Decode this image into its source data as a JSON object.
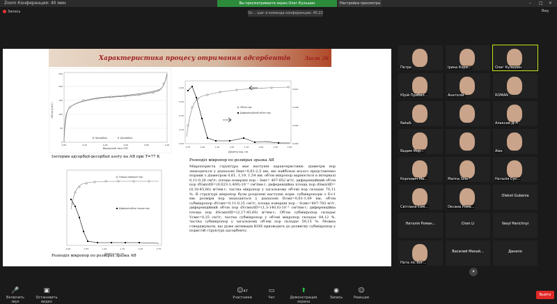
{
  "window": {
    "title": "Zoom Конференция: 40 мин",
    "controls": [
      "–",
      "□",
      "×"
    ]
  },
  "recording": {
    "label": "Запись"
  },
  "banner": {
    "speaking": "Вы просматриваете экран Олег Кульшин",
    "view_options": "Настройки просмотра",
    "role": "Ос… шаг в команда конференции: 45:22"
  },
  "view_button": "Вид",
  "slide": {
    "title": "Характеристика процесу отримання адсорбентів",
    "sheet": "Лист 26",
    "fig1": {
      "caption": "Ізотерми адсорбції-десорбції азоту на АВ при T=77 K",
      "xlabel": "Відносний тиск P/P₀",
      "ylabel": "Об'єм (см³/г)",
      "legend": [
        "Адсорбція",
        "Десорбція"
      ],
      "yticks": [
        "0",
        "50",
        "100",
        "150",
        "200",
        "250"
      ],
      "xticks": [
        "0,00",
        "0,10",
        "0,20",
        "0,30",
        "0,40",
        "0,50",
        "0,60",
        "0,70",
        "0,80",
        "0,90",
        "1,00"
      ]
    },
    "fig2": {
      "caption": "Розподіл мікропор по розмірах зразка АВ",
      "xlabel": "Діаметр пор, нм",
      "legend": [
        "Об'єм пор",
        "Диференційний об'єм пор"
      ],
      "xticks": [
        "0,75",
        "1,00",
        "1,25",
        "1,50",
        "1,75",
        "2,00",
        "2,25",
        "2,50"
      ],
      "yticks_left": [
        "0,00",
        "0,05",
        "0,10",
        "0,15",
        "0,20",
        "0,25",
        "0,30",
        "0,35",
        "0,40",
        "0,45"
      ],
      "yticks_right": [
        "0,000",
        "0,002",
        "0,004",
        "0,006",
        "0,008",
        "0,010",
        "0,012",
        "0,014"
      ]
    },
    "fig3": {
      "caption": "Розподіл мікропор по розмірах зразка АВ",
      "xlabel": "Діаметр пор, нм",
      "legend": [
        "Площа поверхні пор",
        "Диференційна площа пор"
      ],
      "xticks": [
        "0,25",
        "0,75",
        "1,25",
        "1,75",
        "2,25",
        "2,75"
      ]
    },
    "paragraph": "Мікропориста структура має наступні характеристики: діаметри пор знаходяться у діапазоні Dмп=0,61-2,5 нм, які найбільш всього представлено порами з діаметром 0,61, 1,19, 1,54 нм; об'єм мікропор варіюється в інтервалі 0,11-0,26 см³/г; площа поверхні пор – Sмп= 407-852 м²/г; диференційний об'єм пор dVмп/dD=(0,023-1,400)·10⁻³ см³/нм·г; диференційна площа пор dSмп/dD=(0,18-45,60) м²/нм·г; частка мікропор у загальному об'ємі пор складає 70,11 %. В структурі мікропор були розділені наступні пори: субмікропори з D<1 нм; розміри пор знаходяться у діапазоні Dсмп=0,61-1,09 нм; об'єм субмікропор dVсмп=0,11-0,25 см³/г; площа поверхні пор – Sсмп=407-783 м²/г, диференційний об'єм пор dVсмп/dD=(1,3-140,0)·10⁻³ см³/нм·г; диференційна площа пор dSсмп/dD=(2,17-45,60) м²/нм·г; Об'єм субмікропор складає Vсмп=0,25 см³/г; частка субмікропор у об'ємі мікропор складає 84,12 %, частка субмікропор у загальному об'ємі пор складає 59,15 %. Можна стверджувати, що дуже активація КОН призводить до розвитку субмікропор у пористій структурі адсорбенту."
  },
  "participants": [
    {
      "name": "Петро",
      "hl": false
    },
    {
      "name": "Ірина Кори...",
      "hl": false
    },
    {
      "name": "Олег Кульшин",
      "hl": true
    },
    {
      "name": "Юрій Прибил...",
      "hl": false
    },
    {
      "name": "Анатолій",
      "hl": false
    },
    {
      "name": "ROMAN",
      "hl": false
    },
    {
      "name": "Natalk",
      "hl": false
    },
    {
      "name": "",
      "hl": false
    },
    {
      "name": "Алексей Д-Л",
      "hl": false
    },
    {
      "name": "Вадим Мор...",
      "hl": false
    },
    {
      "name": "",
      "hl": false
    },
    {
      "name": "Alex",
      "hl": false
    },
    {
      "name": "Корпович Ма...",
      "hl": false
    },
    {
      "name": "Marina Silia",
      "hl": false
    },
    {
      "name": "Наталія Сус...",
      "hl": false
    },
    {
      "name": "Світлана Сем...",
      "hl": false
    },
    {
      "name": "Оксана Рома...",
      "hl": false
    }
  ],
  "name_tiles": [
    "Oleksii Gubenia",
    "Наталія Роман...",
    "Chen Li",
    "Vasyl Panichnyi",
    "Василий Михай...",
    "Данило"
  ],
  "photo_tile_last": "Ната ліс Бог...",
  "toolbar": {
    "audio": "Включить звук",
    "video": "Остановить видео",
    "participants": "Участники",
    "participants_count": "47",
    "chat": "Чат",
    "share": "Демонстрация экрана",
    "record": "Запись",
    "reactions": "Реакции",
    "end": "Выйти"
  }
}
